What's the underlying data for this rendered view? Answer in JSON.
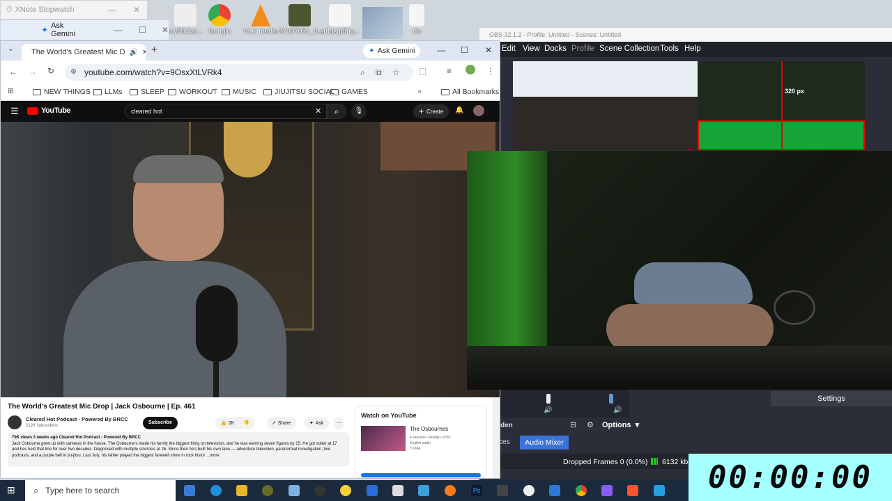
{
  "desktop": {
    "icons": [
      {
        "label": "myRichar...",
        "color": "#e8e8e8"
      },
      {
        "label": "Google",
        "color": "#4285f4"
      },
      {
        "label": "VLC media",
        "color": "#f28c1c"
      },
      {
        "label": "37007051_6...",
        "color": "#556b2f"
      },
      {
        "label": "sdfgsgdfhg...",
        "color": "#e8e8e8"
      },
      {
        "label": "do",
        "color": "#e8e8e8"
      }
    ]
  },
  "xnote": {
    "title": "XNote Stopwatch"
  },
  "gemini_small": {
    "label": "Ask Gemini"
  },
  "chrome": {
    "tab_title": "The World's Greatest Mic D",
    "ask_gemini": "Ask Gemini",
    "url": "youtube.com/watch?v=9OsxXtLVRk4",
    "bookmarks": [
      "NEW THINGS",
      "LLMs",
      "SLEEP",
      "WORKOUT",
      "MUSIC",
      "JIUJITSU SOCIAL",
      "GAMES"
    ],
    "all_bookmarks": "All Bookmarks"
  },
  "youtube": {
    "logo": "YouTube",
    "search_value": "cleared hot",
    "create_label": "Create",
    "video_title": "The World's Greatest Mic Drop | Jack Osbourne | Ep. 461",
    "channel_name": "Cleared Hot Podcast - Powered By BRCC",
    "subscribers": "212K subscribers",
    "subscribe_label": "Subscribe",
    "like_count": "2K",
    "share_label": "Share",
    "ask_label": "Ask",
    "views_line": "79K views  3 weeks ago  Cleared Hot Podcast - Powered By BRCC",
    "description": "Jack Osbourne grew up with cameras in the house. The Osbourne's made his family the biggest thing on television, and he was earning seven figures by 15. He got sober at 17 and has held that line for over two decades. Diagnosed with multiple sclerosis at 26. Since then he's built his own lane — adventure television, paranormal investigation, two podcasts, and a purple belt in jiu-jitsu. Last July, his father played the biggest farewell show in rock histor ...more",
    "watch_on_youtube": "Watch on YouTube",
    "rec_title": "The Osbournes",
    "rec_meta1": "4 seasons • Reality • 2003",
    "rec_meta2": "English audio",
    "rec_meta3": "TV-MA"
  },
  "obs": {
    "title": "OBS 32.1.2 - Profile: Untitled - Scenes: Untitled",
    "menu": [
      "Edit",
      "View",
      "Docks",
      "Profile",
      "Scene Collection",
      "Tools",
      "Help"
    ],
    "settings_label": "Settings",
    "options_label": "Options",
    "audio_mixer_tab": "Audio Mixer",
    "sources_tab": "ces",
    "hidden_label": "den",
    "dropped_frames": "Dropped Frames 0 (0.0%)",
    "bitrate": "6132 kb",
    "preview_size": "320 px"
  },
  "timer": {
    "value": "00:00:00"
  },
  "taskbar": {
    "search_placeholder": "Type here to search"
  }
}
